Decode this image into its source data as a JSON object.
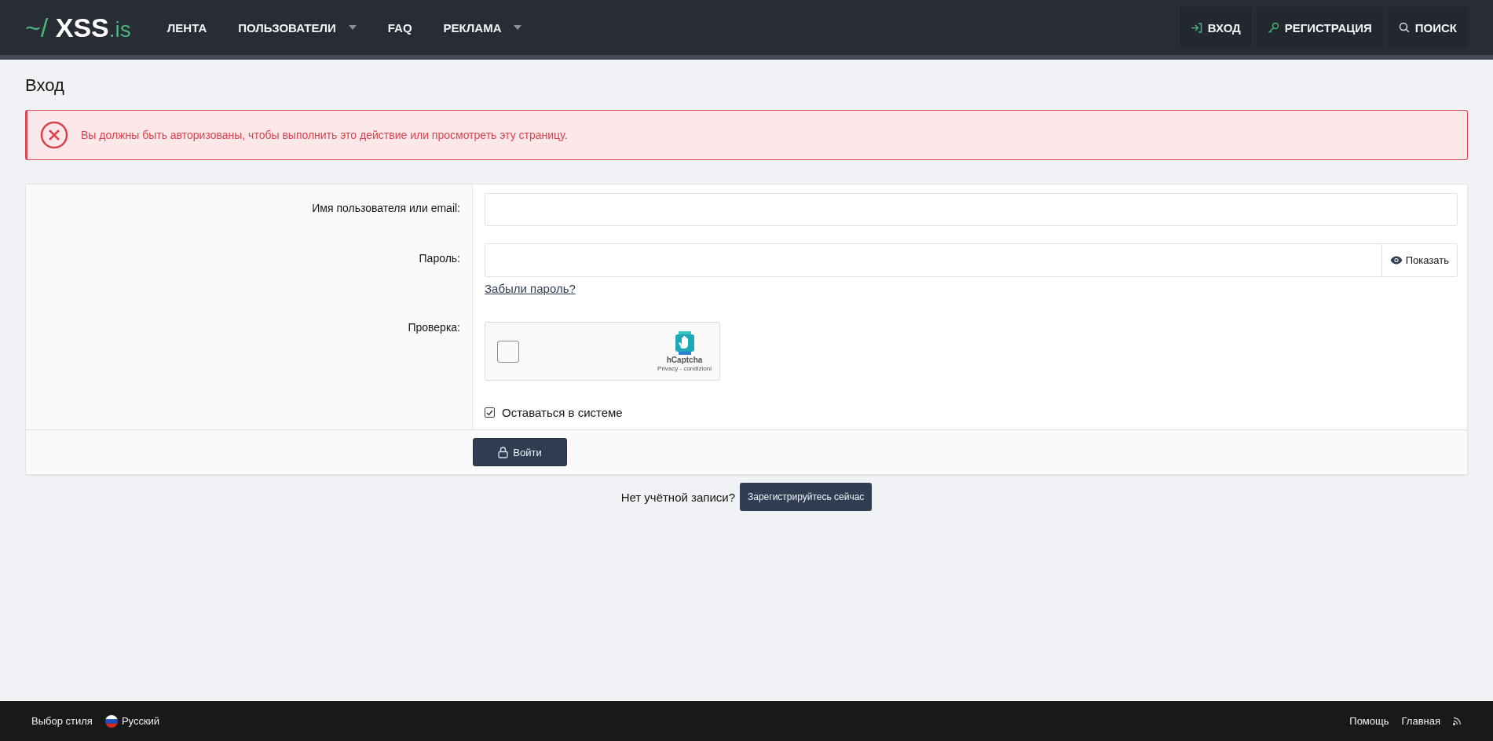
{
  "header": {
    "logo": {
      "prefix": "~/",
      "name": "XSS",
      "suffix": ".is"
    },
    "nav": [
      {
        "label": "ЛЕНТА",
        "has_menu": false
      },
      {
        "label": "ПОЛЬЗОВАТЕЛИ",
        "has_menu": true
      },
      {
        "label": "FAQ",
        "has_menu": false
      },
      {
        "label": "РЕКЛАМА",
        "has_menu": true
      }
    ],
    "actions": [
      {
        "kind": "login",
        "label": "ВХОД"
      },
      {
        "kind": "register",
        "label": "РЕГИСТРАЦИЯ"
      },
      {
        "kind": "search",
        "label": "ПОИСК"
      }
    ]
  },
  "page_title": "Вход",
  "alert": {
    "message": "Вы должны быть авторизованы, чтобы выполнить это действие или просмотреть эту страницу."
  },
  "form": {
    "username": {
      "label": "Имя пользователя или email:"
    },
    "password": {
      "label": "Пароль:",
      "toggle": "Показать",
      "forgot": "Забыли пароль?"
    },
    "captcha": {
      "label": "Проверка:",
      "checked": false,
      "brand": "hCaptcha",
      "links": "Privacy - condizioni"
    },
    "remember": {
      "label": "Оставаться в системе",
      "checked": true
    },
    "submit": "Войти"
  },
  "register_prompt": {
    "text": "Нет учётной записи?",
    "button": "Зарегистрируйтесь сейчас"
  },
  "footer": {
    "style_chooser": "Выбор стиля",
    "language": "Русский",
    "links": [
      "Помощь",
      "Главная"
    ]
  }
}
